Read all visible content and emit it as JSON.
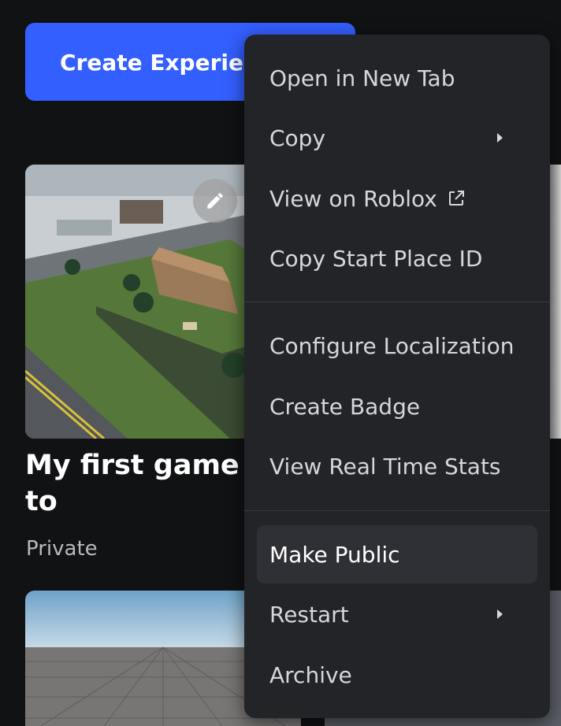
{
  "create_button": {
    "label": "Create Experience"
  },
  "card": {
    "title": "My first game to\npublish!",
    "status": "Private"
  },
  "context_menu": {
    "items": [
      {
        "label": "Open in New Tab"
      },
      {
        "label": "Copy",
        "submenu": true
      },
      {
        "label": "View on Roblox",
        "external": true
      },
      {
        "label": "Copy Start Place ID"
      },
      {
        "label": "Configure Localization"
      },
      {
        "label": "Create Badge"
      },
      {
        "label": "View Real Time Stats"
      },
      {
        "label": "Make Public",
        "highlighted": true
      },
      {
        "label": "Restart",
        "submenu": true
      },
      {
        "label": "Archive"
      }
    ]
  },
  "colors": {
    "accent": "#335fff",
    "menu_bg": "#232428",
    "page_bg": "#111214"
  }
}
